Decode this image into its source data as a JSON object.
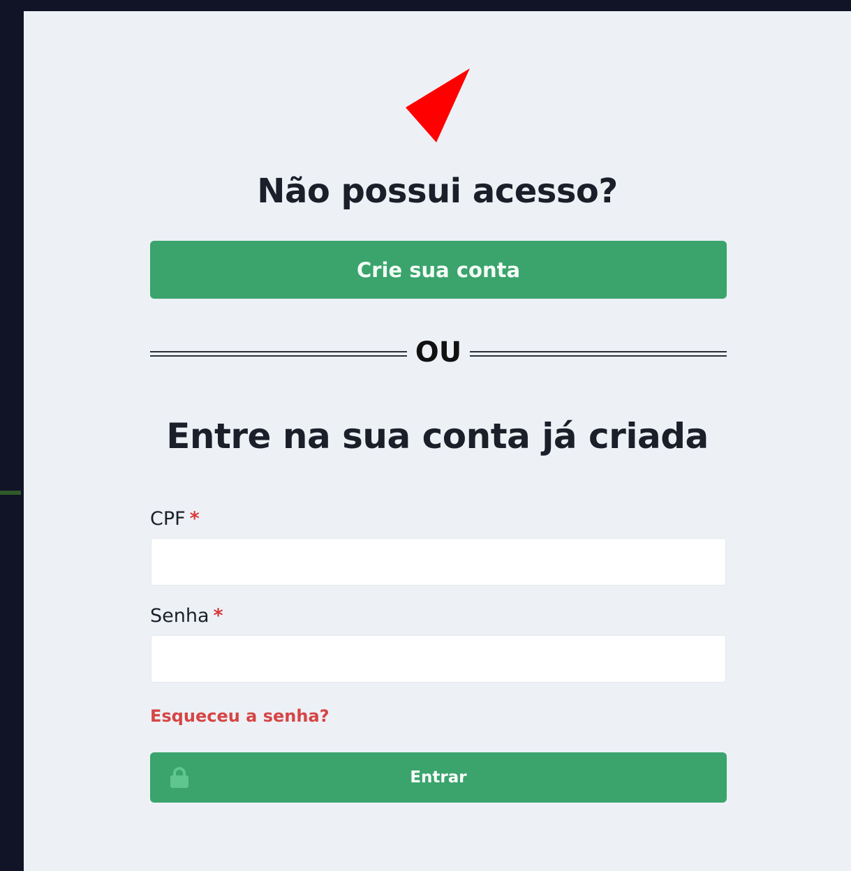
{
  "signup": {
    "heading": "Não possui acesso?",
    "button_label": "Crie sua conta"
  },
  "divider": {
    "label": "OU"
  },
  "login": {
    "heading": "Entre na sua conta já criada",
    "cpf_label": "CPF",
    "cpf_value": "",
    "password_label": "Senha",
    "password_value": "",
    "required_mark": "*",
    "forgot_link": "Esqueceu a senha?",
    "submit_label": "Entrar"
  },
  "colors": {
    "background": "#111427",
    "panel": "#edf1f6",
    "primary_button": "#3aa46c",
    "logo": "#ff0000",
    "link": "#d64545"
  },
  "icons": {
    "logo": "red-arrow-logo-icon",
    "submit": "lock-icon"
  }
}
